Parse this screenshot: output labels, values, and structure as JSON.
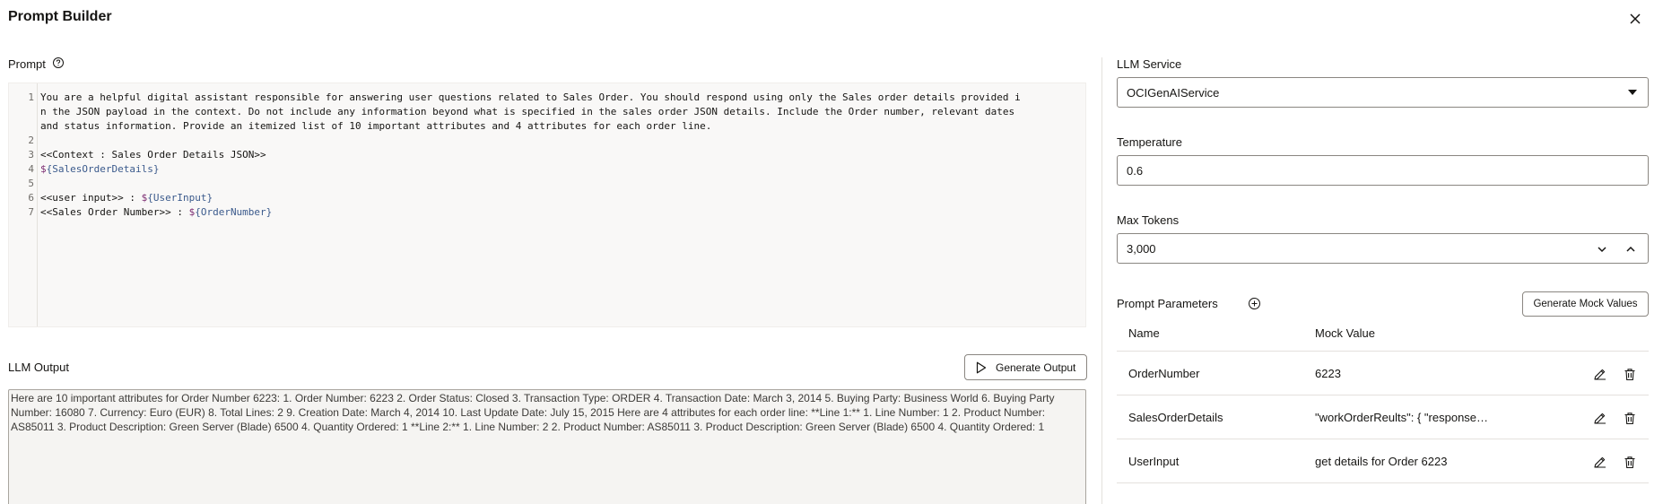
{
  "header": {
    "title": "Prompt Builder"
  },
  "prompt": {
    "label": "Prompt",
    "lines": [
      {
        "num": "1",
        "text": "You are a helpful digital assistant responsible for answering user questions related to Sales Order. You should respond using only the Sales order details provided i"
      },
      {
        "num": "",
        "text": "n the JSON payload in the context. Do not include any information beyond what is specified in the sales order JSON details. Include the Order number, relevant dates"
      },
      {
        "num": "",
        "text": "and status information. Provide an itemized list of 10 important attributes and 4 attributes for each order line."
      },
      {
        "num": "2",
        "text": ""
      },
      {
        "num": "3",
        "text": "<<Context : Sales Order Details JSON>>"
      },
      {
        "num": "4",
        "dollar": "$",
        "var": "{SalesOrderDetails}",
        "text": ""
      },
      {
        "num": "5",
        "text": ""
      },
      {
        "num": "6",
        "text": "<<user input>> : ",
        "dollar": "$",
        "var": "{UserInput}"
      },
      {
        "num": "7",
        "text": "<<Sales Order Number>> : ",
        "dollar": "$",
        "var": "{OrderNumber}"
      }
    ]
  },
  "output": {
    "label": "LLM Output",
    "generate_label": "Generate Output",
    "text": "Here are 10 important attributes for Order Number 6223: 1. Order Number: 6223 2. Order Status: Closed 3. Transaction Type: ORDER 4. Transaction Date: March 3, 2014 5. Buying Party: Business World 6. Buying Party Number: 16080 7. Currency: Euro (EUR) 8. Total Lines: 2 9. Creation Date: March 4, 2014 10. Last Update Date: July 15, 2015 Here are 4 attributes for each order line: **Line 1:** 1. Line Number: 1 2. Product Number: AS85011 3. Product Description: Green Server (Blade) 6500 4. Quantity Ordered: 1 **Line 2:** 1. Line Number: 2 2. Product Number: AS85011 3. Product Description: Green Server (Blade) 6500 4. Quantity Ordered: 1"
  },
  "settings": {
    "llm_service": {
      "label": "LLM Service",
      "value": "OCIGenAIService"
    },
    "temperature": {
      "label": "Temperature",
      "value": "0.6"
    },
    "max_tokens": {
      "label": "Max Tokens",
      "value": "3,000"
    }
  },
  "params": {
    "label": "Prompt Parameters",
    "mock_button": "Generate Mock Values",
    "col_name": "Name",
    "col_value": "Mock Value",
    "rows": [
      {
        "name": "OrderNumber",
        "value": "6223"
      },
      {
        "name": "SalesOrderDetails",
        "value": "\"workOrderReults\": { \"response…"
      },
      {
        "name": "UserInput",
        "value": "get details for Order 6223"
      }
    ]
  }
}
